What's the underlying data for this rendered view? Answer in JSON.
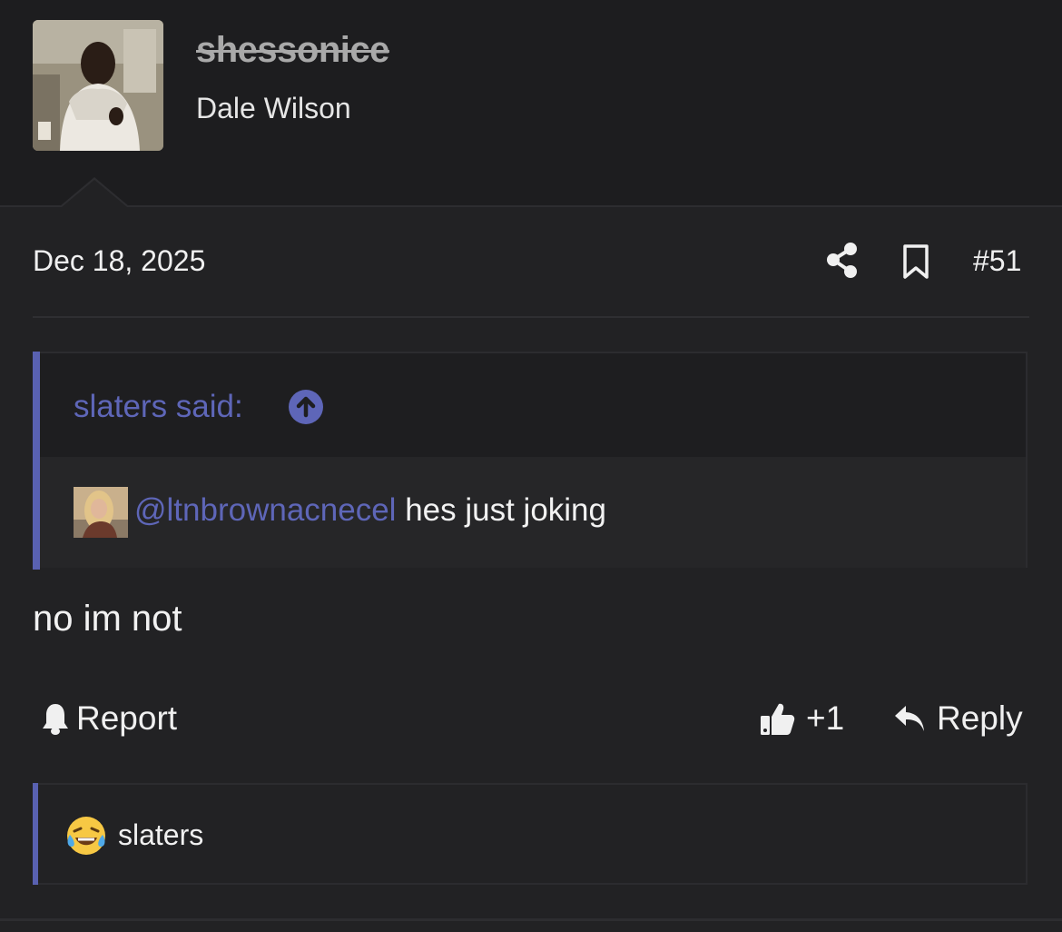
{
  "author": {
    "username": "shessonice",
    "display_name": "Dale Wilson",
    "avatar_icon": "user-avatar-photo"
  },
  "post": {
    "date": "Dec 18, 2025",
    "number": "#51",
    "share_icon": "share-icon",
    "bookmark_icon": "bookmark-icon",
    "quote": {
      "author_label": "slaters said:",
      "jump_icon": "arrow-up-circle-icon",
      "mention": "@ltnbrownacnecel",
      "text": " hes just joking"
    },
    "body": "no im not",
    "actions": {
      "report_label": "Report",
      "like_count": "+1",
      "reply_label": "Reply"
    },
    "reactions": {
      "emoji": "face-with-tears-of-joy",
      "users": "slaters"
    }
  },
  "colors": {
    "background": "#1d1d1f",
    "post_background": "#222224",
    "accent": "#5e66b8",
    "text": "#f0f0f0",
    "muted_username": "#a9a9a9"
  }
}
